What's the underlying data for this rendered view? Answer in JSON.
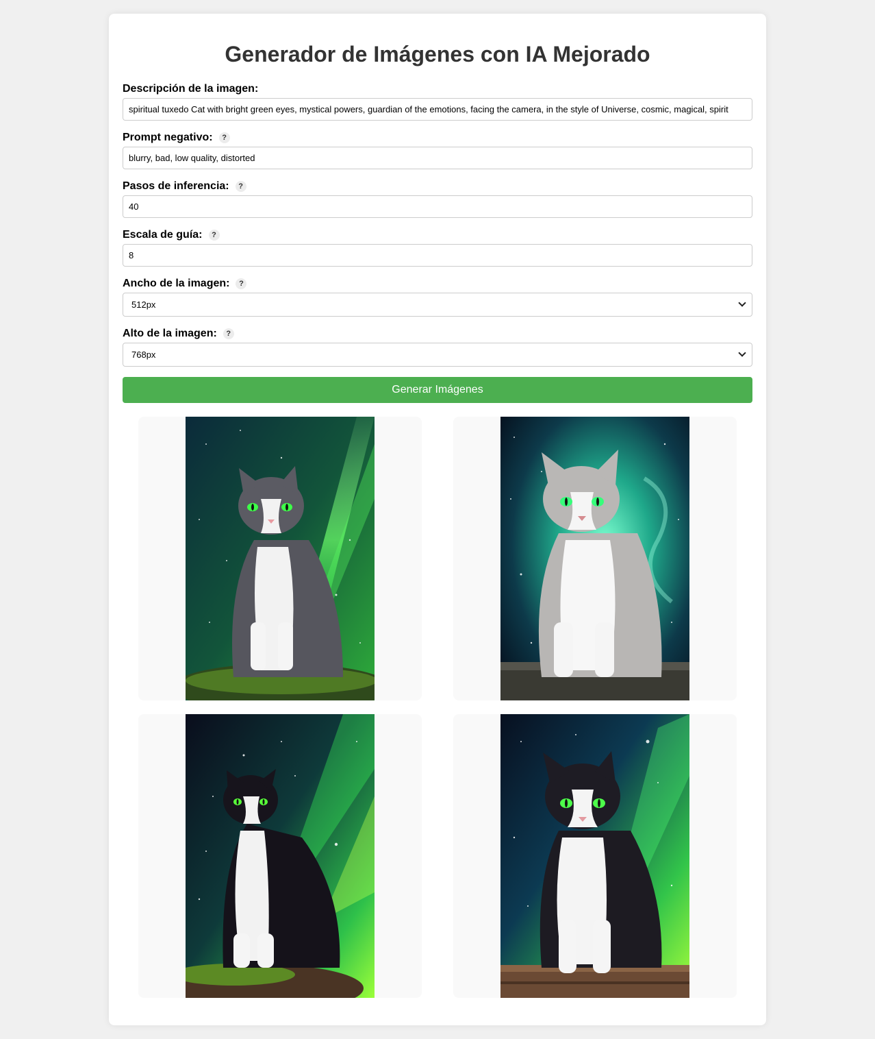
{
  "title": "Generador de Imágenes con IA Mejorado",
  "form": {
    "description": {
      "label": "Descripción de la imagen:",
      "value": "spiritual tuxedo Cat with bright green eyes,  mystical powers, guardian of the emotions, facing the camera, in the style of Universe, cosmic, magical, spirit"
    },
    "negative_prompt": {
      "label": "Prompt negativo:",
      "help": "?",
      "value": "blurry, bad, low quality, distorted"
    },
    "steps": {
      "label": "Pasos de inferencia:",
      "help": "?",
      "value": "40"
    },
    "guidance": {
      "label": "Escala de guía:",
      "help": "?",
      "value": "8"
    },
    "width": {
      "label": "Ancho de la imagen:",
      "help": "?",
      "selected": "512px"
    },
    "height": {
      "label": "Alto de la imagen:",
      "help": "?",
      "selected": "768px"
    },
    "submit_label": "Generar Imágenes"
  },
  "gallery": {
    "images": [
      {
        "subject": "tuxedo cat, gray and white, green eyes, green cosmic beam background, mossy rock"
      },
      {
        "subject": "gray and white cat, green eyes, teal nebula background, stone ledge"
      },
      {
        "subject": "black and white tuxedo cat looking up, green aurora starry sky, mossy log"
      },
      {
        "subject": "black and white cat, green eyes, green galaxy background, wooden platform"
      }
    ]
  },
  "colors": {
    "accent": "#4caf50",
    "page_bg": "#f0f0f0",
    "card_bg": "#ffffff",
    "title": "#333333"
  }
}
